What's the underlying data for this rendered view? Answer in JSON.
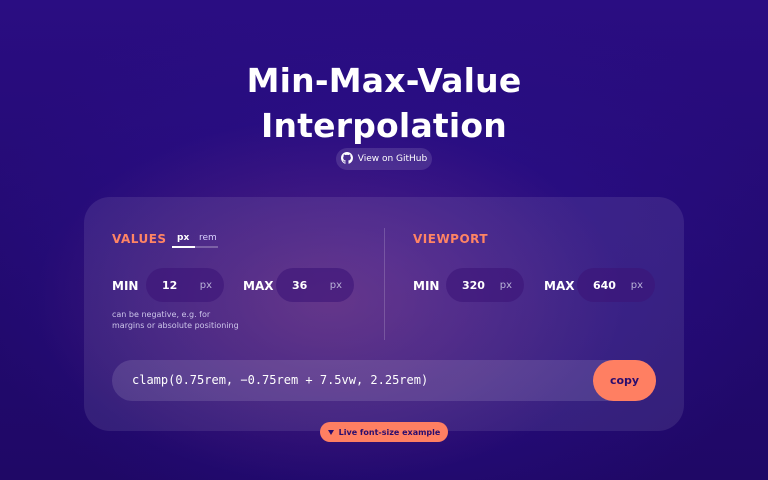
{
  "header": {
    "title_line1": "Min-Max-Value",
    "title_line2": "Interpolation",
    "github_label": "View on GitHub"
  },
  "values": {
    "label": "VALUES",
    "unit_options": [
      "px",
      "rem"
    ],
    "selected_unit": "px",
    "min_label": "MIN",
    "min_value": "12",
    "min_unit": "px",
    "max_label": "MAX",
    "max_value": "36",
    "max_unit": "px",
    "hint": "can be negative, e.g. for margins or absolute positioning"
  },
  "viewport": {
    "label": "VIEWPORT",
    "min_label": "MIN",
    "min_value": "320",
    "min_unit": "px",
    "max_label": "MAX",
    "max_value": "640",
    "max_unit": "px"
  },
  "output": {
    "clamp": "clamp(0.75rem, −0.75rem + 7.5vw, 2.25rem)",
    "copy_label": "copy"
  },
  "example": {
    "label": "Live font-size example"
  },
  "colors": {
    "accent": "#ff7f62",
    "background": "#2a0d82"
  },
  "icons": {
    "github": "github-icon",
    "example": "triangle-down-icon"
  }
}
